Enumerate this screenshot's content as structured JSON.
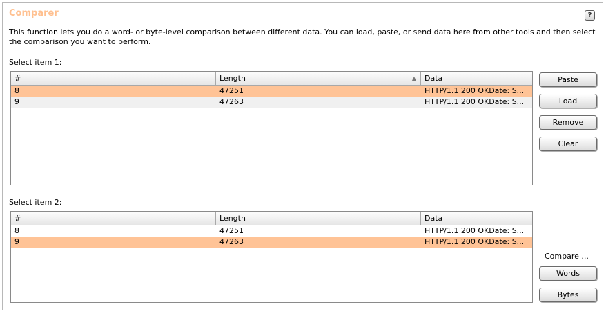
{
  "title": "Comparer",
  "help_label": "?",
  "description": "This function lets you do a word- or byte-level comparison between different data. You can load, paste, or send data here from other tools and then select the comparison you want to perform.",
  "item1": {
    "label": "Select item 1:",
    "columns": [
      "#",
      "Length",
      "Data"
    ],
    "sort_column": "Length",
    "rows": [
      {
        "num": "8",
        "length": "47251",
        "data": "HTTP/1.1 200 OKDate: S...",
        "selected": true
      },
      {
        "num": "9",
        "length": "47263",
        "data": "HTTP/1.1 200 OKDate: S...",
        "selected": false
      }
    ]
  },
  "item2": {
    "label": "Select item 2:",
    "columns": [
      "#",
      "Length",
      "Data"
    ],
    "rows": [
      {
        "num": "8",
        "length": "47251",
        "data": "HTTP/1.1 200 OKDate: S...",
        "selected": false
      },
      {
        "num": "9",
        "length": "47263",
        "data": "HTTP/1.1 200 OKDate: S...",
        "selected": true
      }
    ]
  },
  "buttons": {
    "paste": "Paste",
    "load": "Load",
    "remove": "Remove",
    "clear": "Clear"
  },
  "compare": {
    "label": "Compare ...",
    "words": "Words",
    "bytes": "Bytes"
  },
  "colors": {
    "title": "#ffc090",
    "selected_row": "#ffc396"
  }
}
